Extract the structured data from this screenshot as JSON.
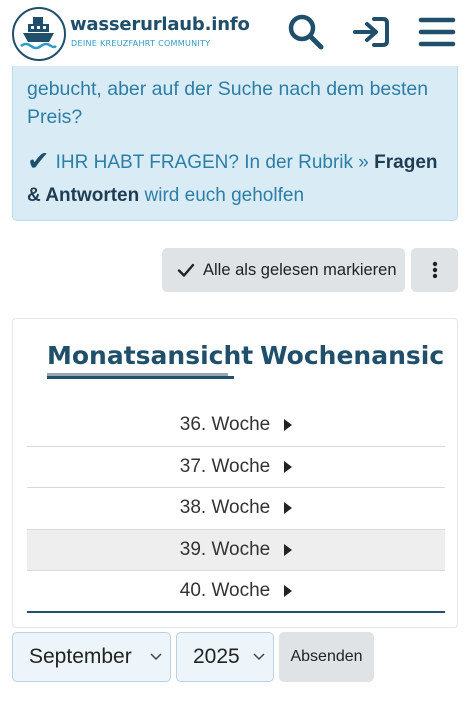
{
  "header": {
    "brand_name": "wasserurlaub.info",
    "brand_tagline": "DEINE KREUZFAHRT COMMUNITY",
    "icons": [
      "search-icon",
      "login-icon",
      "menu-icon"
    ],
    "brand_color": "#1f4f6b"
  },
  "info_box": {
    "text": "gebucht, aber auf der Suche nach dem besten Preis?",
    "question_prefix": "IHR HABT FRAGEN? In der Rubrik » ",
    "question_link": "Fragen & Antworten",
    "question_suffix": " wird euch geholfen",
    "background": "#d9ecf5"
  },
  "toolbar": {
    "mark_read_label": "Alle als gelesen markieren"
  },
  "calendar": {
    "tabs": [
      {
        "label": "Monatsansicht",
        "active": true
      },
      {
        "label": "Wochenansic",
        "active": false
      }
    ],
    "weeks": [
      {
        "label": "36. Woche",
        "highlight": false
      },
      {
        "label": "37. Woche",
        "highlight": false
      },
      {
        "label": "38. Woche",
        "highlight": false
      },
      {
        "label": "39. Woche",
        "highlight": true
      },
      {
        "label": "40. Woche",
        "highlight": false
      }
    ]
  },
  "form": {
    "month_value": "September",
    "year_value": "2025",
    "submit_label": "Absenden"
  }
}
